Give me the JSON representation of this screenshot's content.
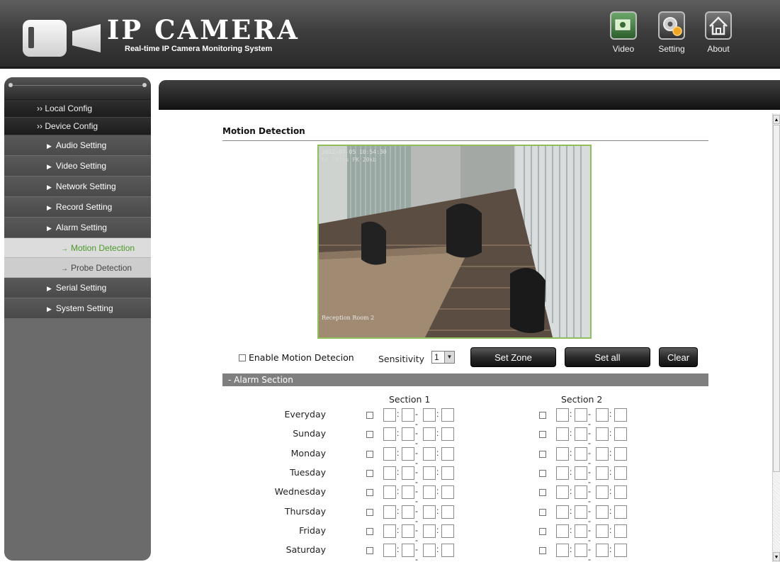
{
  "header": {
    "brand_title": "IP CAMERA",
    "brand_subtitle": "Real-time IP Camera Monitoring System",
    "nav": [
      {
        "label": "Video",
        "icon": "video-icon"
      },
      {
        "label": "Setting",
        "icon": "gear-icon"
      },
      {
        "label": "About",
        "icon": "home-icon"
      }
    ]
  },
  "sidebar": {
    "groups": [
      {
        "label": "Local Config"
      },
      {
        "label": "Device Config"
      }
    ],
    "items": [
      {
        "label": "Audio Setting"
      },
      {
        "label": "Video Setting"
      },
      {
        "label": "Network Setting"
      },
      {
        "label": "Record Setting"
      },
      {
        "label": "Alarm Setting"
      }
    ],
    "subitems": [
      {
        "label": "Motion Detection",
        "active": true
      },
      {
        "label": "Probe Detection",
        "active": false
      }
    ],
    "items_after": [
      {
        "label": "Serial Setting"
      },
      {
        "label": "System Setting"
      }
    ]
  },
  "main": {
    "section_title": "Motion Detection",
    "camera": {
      "timestamp": "2012-07-05 10:54:30",
      "fps_info": "FK 25fps FK 20kb",
      "overlay_label": "Reception Room 2"
    },
    "enable_label": "Enable Motion Detecion",
    "enable_checked": false,
    "sensitivity_label": "Sensitivity",
    "sensitivity_value": "1",
    "buttons": {
      "set_zone": "Set Zone",
      "set_all": "Set all",
      "clear": "Clear"
    },
    "alarm_section": {
      "header": "- Alarm Section",
      "section1": "Section 1",
      "section2": "Section 2",
      "days": [
        "Everyday",
        "Sunday",
        "Monday",
        "Tuesday",
        "Wednesday",
        "Thursday",
        "Friday",
        "Saturday"
      ]
    }
  },
  "colors": {
    "active_sidebar_text": "#4b9a2a",
    "camera_border": "#8fbf5a"
  }
}
